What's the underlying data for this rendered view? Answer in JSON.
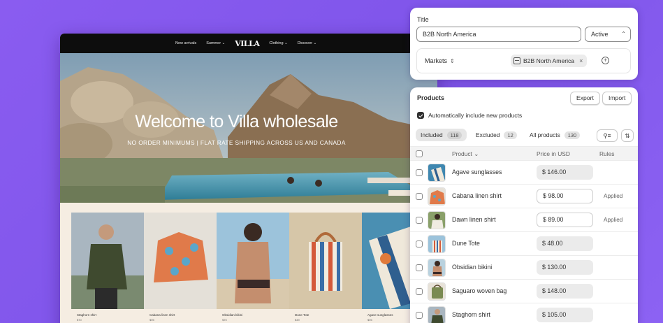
{
  "store": {
    "nav": [
      "New arrivals",
      "Summer ⌄",
      "Clothing ⌄",
      "Discover ⌄"
    ],
    "logo": "VILLA",
    "hero_title": "Welcome to Villa wholesale",
    "hero_subtitle": "NO ORDER MINIMUMS | FLAT RATE SHIPPING ACROSS US AND CANADA",
    "tiles": [
      {
        "label": "Staghorn shirt",
        "price": "$70"
      },
      {
        "label": "Cabana linen shirt",
        "price": "$95"
      },
      {
        "label": "Obsidian bikini",
        "price": "$70"
      },
      {
        "label": "Dune Tote",
        "price": "$49"
      },
      {
        "label": "Agave sunglasses",
        "price": "$95"
      }
    ]
  },
  "title_card": {
    "label": "Title",
    "value": "B2B North America",
    "status": "Active",
    "markets_label": "Markets",
    "market_tag": "B2B North America"
  },
  "products": {
    "title": "Products",
    "export": "Export",
    "import": "Import",
    "auto_include": "Automatically include new products",
    "tabs": [
      {
        "label": "Included",
        "count": "118"
      },
      {
        "label": "Excluded",
        "count": "12"
      },
      {
        "label": "All products",
        "count": "130"
      }
    ],
    "columns": {
      "product": "Product",
      "price": "Price in USD",
      "rules": "Rules"
    },
    "rows": [
      {
        "name": "Agave sunglasses",
        "price": "$ 146.00",
        "rule": "",
        "style": "filled"
      },
      {
        "name": "Cabana linen shirt",
        "price": "$ 98.00",
        "rule": "Applied",
        "style": "outline"
      },
      {
        "name": "Dawn linen shirt",
        "price": "$ 89.00",
        "rule": "Applied",
        "style": "outline"
      },
      {
        "name": "Dune Tote",
        "price": "$ 48.00",
        "rule": "",
        "style": "filled"
      },
      {
        "name": "Obsidian bikini",
        "price": "$ 130.00",
        "rule": "",
        "style": "filled"
      },
      {
        "name": "Saguaro woven bag",
        "price": "$ 148.00",
        "rule": "",
        "style": "filled"
      },
      {
        "name": "Staghorn shirt",
        "price": "$ 105.00",
        "rule": "",
        "style": "filled"
      }
    ]
  }
}
